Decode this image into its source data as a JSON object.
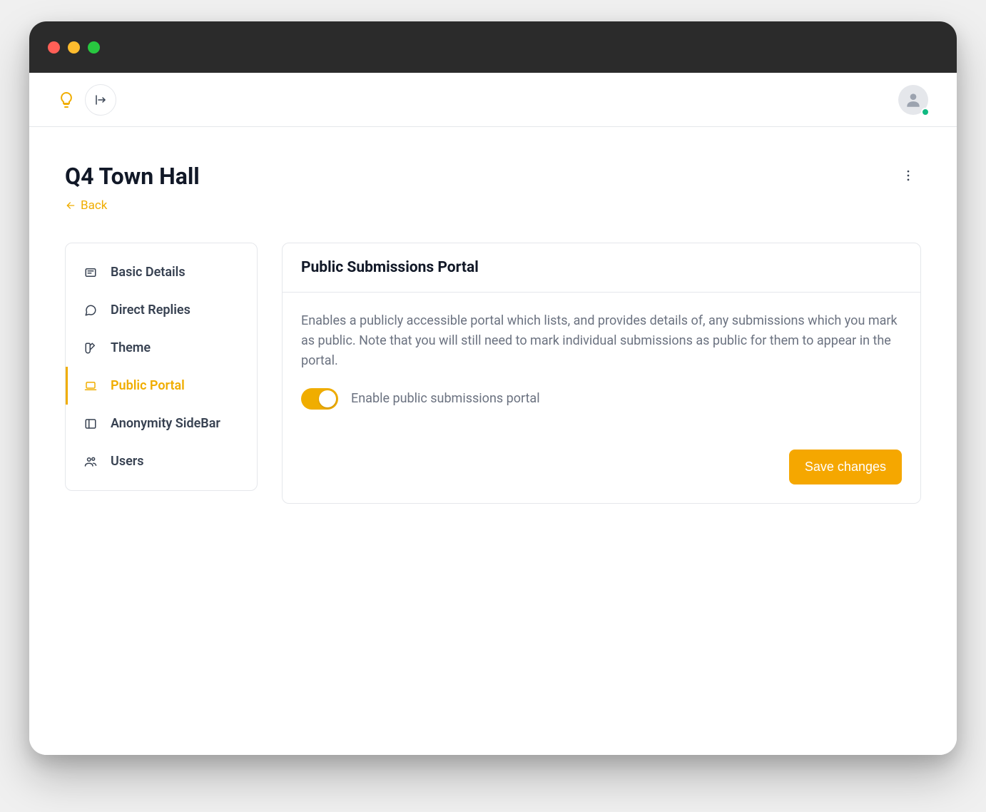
{
  "page": {
    "title": "Q4 Town Hall",
    "back_label": "Back"
  },
  "sidebar": {
    "items": [
      {
        "label": "Basic Details",
        "icon": "list-icon",
        "active": false
      },
      {
        "label": "Direct Replies",
        "icon": "chat-icon",
        "active": false
      },
      {
        "label": "Theme",
        "icon": "swatch-icon",
        "active": false
      },
      {
        "label": "Public Portal",
        "icon": "laptop-icon",
        "active": true
      },
      {
        "label": "Anonymity SideBar",
        "icon": "panel-icon",
        "active": false
      },
      {
        "label": "Users",
        "icon": "users-icon",
        "active": false
      }
    ]
  },
  "panel": {
    "title": "Public Submissions Portal",
    "description": "Enables a publicly accessible portal which lists, and provides details of, any submissions which you mark as public. Note that you will still need to mark individual submissions as public for them to appear in the portal.",
    "toggle_label": "Enable public submissions portal",
    "toggle_on": true,
    "save_label": "Save changes"
  }
}
